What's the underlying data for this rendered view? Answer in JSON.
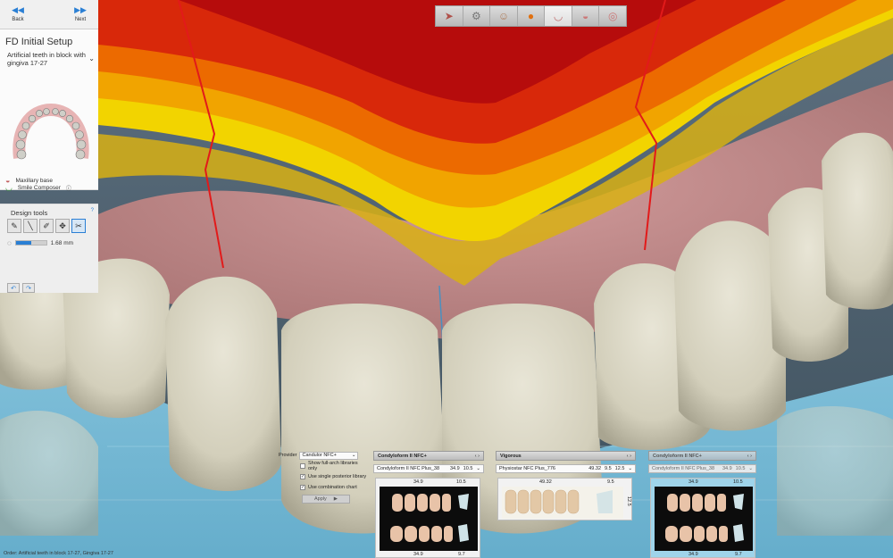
{
  "nav": {
    "back_label": "Back",
    "next_label": "Next"
  },
  "setup": {
    "title": "FD Initial Setup",
    "subtitle": "Artificial teeth in block with gingiva 17-27",
    "smile_composer_label": "Smile Composer",
    "maxillary_base_label": "Maxillary base"
  },
  "design_tools": {
    "title": "Design tools",
    "help": "?",
    "thickness_value": "1.68 mm",
    "thickness_fraction": 0.5
  },
  "provider": {
    "label": "Provider",
    "selected": "Candulor NFC+",
    "options": [
      {
        "label": "Show full-arch libraries only",
        "checked": false
      },
      {
        "label": "Use single posterior library",
        "checked": true
      },
      {
        "label": "Use combination chart",
        "checked": true
      }
    ],
    "apply_label": "Apply"
  },
  "libraries": [
    {
      "name": "Condyloform II NFC+",
      "selection": "Condyloform II NFC Plus_38",
      "m1": "34.9",
      "m2": "10.5",
      "top_left": "34.9",
      "top_right": "10.5",
      "bottom_left": "34.9",
      "bottom_right": "9.7",
      "selected": false
    },
    {
      "name": "Vigorous",
      "selection": "Physiostar NFC Plus_776",
      "m1": "49.32",
      "m2": "9.5",
      "m3": "12.5",
      "top_left": "49.32",
      "top_right": "9.5",
      "side": "12.5",
      "selected": false
    },
    {
      "name": "Condyloform II NFC+",
      "selection": "Condyloform II NFC Plus_38",
      "m1": "34.9",
      "m2": "10.5",
      "top_left": "34.9",
      "top_right": "10.5",
      "bottom_left": "34.9",
      "bottom_right": "9.7",
      "selected": true
    }
  ],
  "status": {
    "text": "Order:   Artificial teeth in block 17-27, Gingiva 17-27"
  },
  "colors": {
    "accent": "#2a7fd4",
    "gingiva": "#c48d8d",
    "tooth": "#ddd9c6"
  }
}
